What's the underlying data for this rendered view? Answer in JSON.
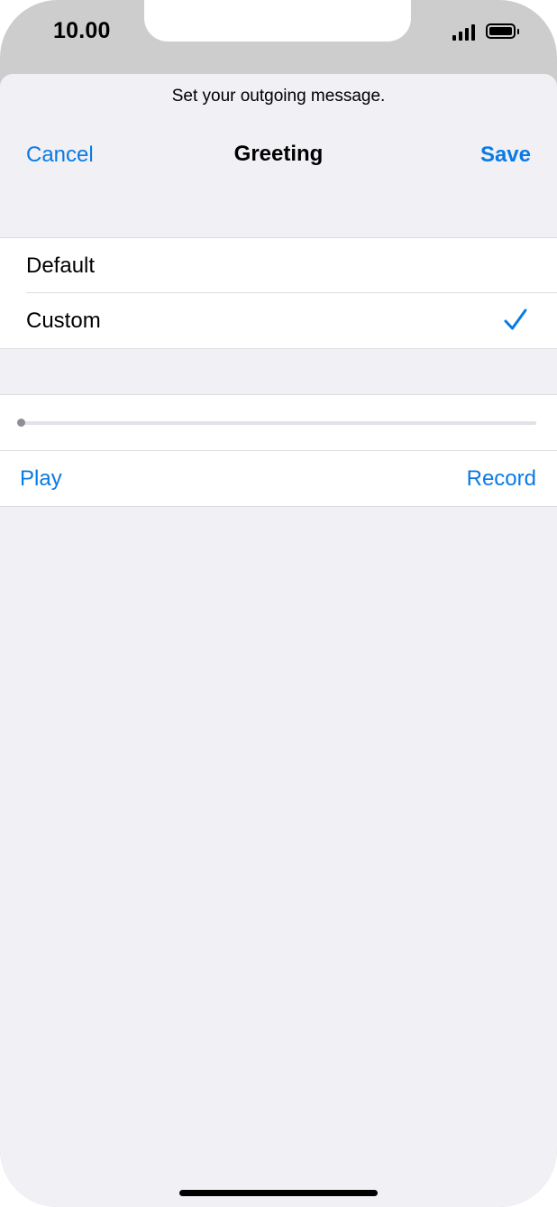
{
  "status_bar": {
    "time": "10.00",
    "signal_icon": "cellular-signal-icon",
    "battery_icon": "battery-full-icon"
  },
  "header": {
    "prompt": "Set your outgoing message.",
    "cancel_label": "Cancel",
    "title": "Greeting",
    "save_label": "Save"
  },
  "greeting_options": {
    "items": [
      {
        "label": "Default",
        "selected": false
      },
      {
        "label": "Custom",
        "selected": true
      }
    ],
    "check_icon": "checkmark-icon"
  },
  "playback": {
    "progress": 0.0,
    "play_label": "Play",
    "record_label": "Record"
  },
  "colors": {
    "accent": "#0a7ae5",
    "background": "#f0f0f5",
    "cell": "#ffffff",
    "separator": "#dcdce0"
  }
}
